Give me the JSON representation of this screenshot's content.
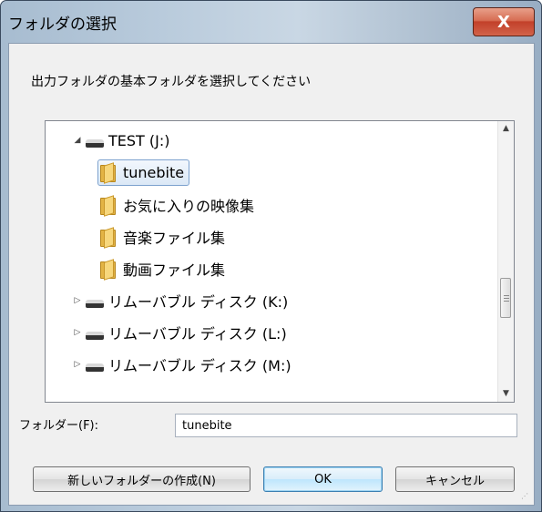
{
  "window": {
    "title": "フォルダの選択",
    "close_glyph": "X"
  },
  "description": "出力フォルダの基本フォルダを選択してください",
  "tree": {
    "items": [
      {
        "label": "TEST (J:)",
        "icon": "drive-icon",
        "expander": "◢",
        "state": "expanded"
      },
      {
        "label": "tunebite",
        "icon": "folder-icon",
        "selected": true
      },
      {
        "label": "お気に入りの映像集",
        "icon": "folder-icon"
      },
      {
        "label": "音楽ファイル集",
        "icon": "folder-icon"
      },
      {
        "label": "動画ファイル集",
        "icon": "folder-icon"
      },
      {
        "label": "リムーバブル ディスク (K:)",
        "icon": "drive-icon",
        "expander": "▷",
        "state": "collapsed"
      },
      {
        "label": "リムーバブル ディスク (L:)",
        "icon": "drive-icon",
        "expander": "▷",
        "state": "collapsed"
      },
      {
        "label": "リムーバブル ディスク (M:)",
        "icon": "drive-icon",
        "expander": "▷",
        "state": "collapsed"
      }
    ],
    "scroll_up": "▲",
    "scroll_down": "▼"
  },
  "folder_field": {
    "label": "フォルダー(F):",
    "value": "tunebite"
  },
  "buttons": {
    "new_folder": "新しいフォルダーの作成(N)",
    "ok": "OK",
    "cancel": "キャンセル"
  },
  "colors": {
    "selection": "#dbe8f6",
    "close_button": "#c2402a"
  }
}
